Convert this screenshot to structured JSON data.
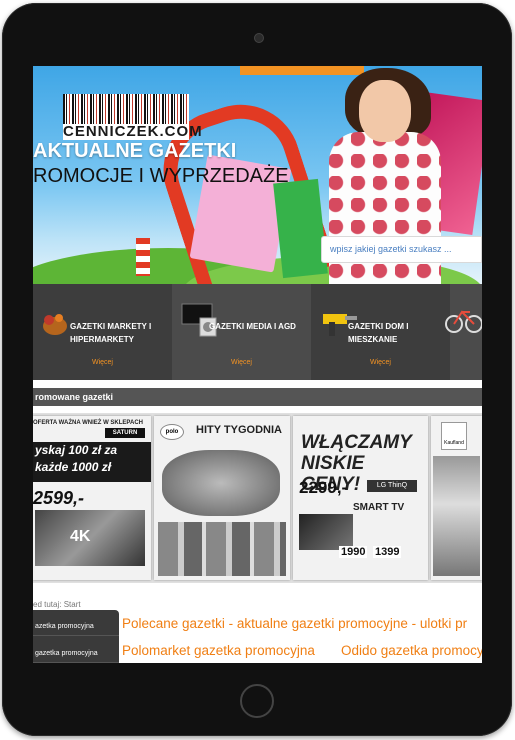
{
  "site": {
    "logo_text": "CENNICZEK.COM"
  },
  "hero": {
    "title_line1": "AKTUALNE GAZETKI",
    "title_line2": "ROMOCJE I WYPRZEDAŻE",
    "search_placeholder": "wpisz jakiej gazetki szukasz ..."
  },
  "categories": [
    {
      "label": "GAZETKI MARKETY I HIPERMARKETY",
      "more": "Więcej"
    },
    {
      "label": "GAZETKI MEDIA I AGD",
      "more": "Więcej"
    },
    {
      "label": "GAZETKI DOM I MIESZKANIE",
      "more": "Więcej"
    }
  ],
  "promoted": {
    "heading": "romowane gazetki",
    "flyers": [
      {
        "store": "SATURN",
        "top_text": "OFERTA WAŻNA WNIEŻ W SKLEPACH",
        "headline": "yskaj 100 zł za każde 1000 zł",
        "price": "2599,-",
        "badge": "4K"
      },
      {
        "store": "polo",
        "headline": "HITY TYGODNIA"
      },
      {
        "headline": "WŁĄCZAMY NISKIE CENY!",
        "price": "2299,-",
        "brand": "LG ThinQ",
        "product": "SMART TV",
        "price2": "1990",
        "price3": "1399"
      },
      {
        "store": "Kaufland"
      }
    ]
  },
  "breadcrumb": "ed tutaj: Start",
  "sidebar": {
    "items": [
      "azetka promocyjna",
      "gazetka promocyjna"
    ]
  },
  "content": {
    "headline": "Polecane gazetki - aktualne gazetki promocyjne - ulotki pr",
    "link1": "Polomarket gazetka promocyjna",
    "link2": "Odido gazetka promocyjna"
  }
}
